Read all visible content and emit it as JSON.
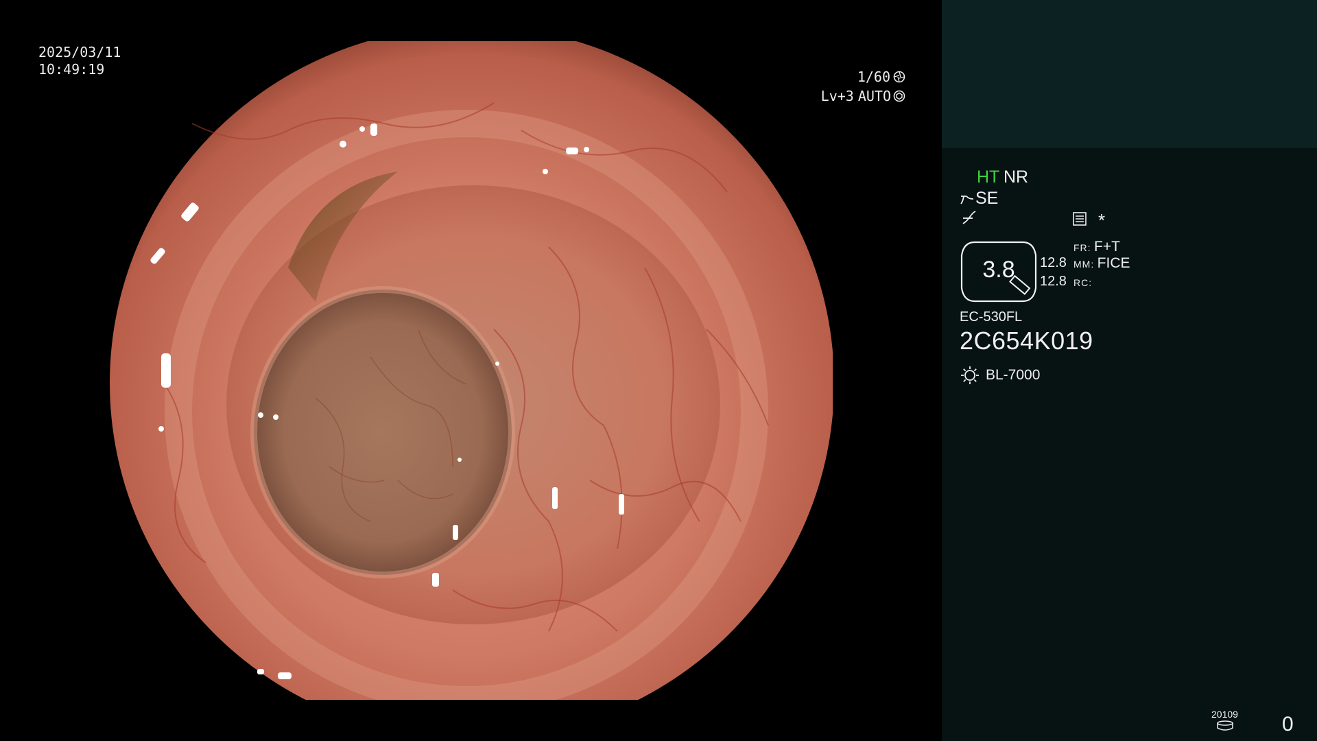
{
  "overlay": {
    "date": "2025/03/11",
    "time": "10:49:19",
    "shutter": "1/60",
    "shutter_icon": "aperture-icon",
    "level": "Lv+3",
    "exposure_mode": "AUTO",
    "exposure_icon": "iris-icon"
  },
  "panel": {
    "ht_label": "HT",
    "nr_label": "NR",
    "se_label": "SE",
    "star_label": "*",
    "zoom_value": "3.8",
    "value_1": "12.8",
    "value_2": "12.8",
    "mode_fr_key": "FR:",
    "mode_fr_val": "F+T",
    "mode_mm_key": "MM:",
    "mode_mm_val": "FICE",
    "mode_rc_key": "RC:",
    "mode_rc_val": "",
    "scope_model": "EC-530FL",
    "scope_serial": "2C654K019",
    "light_source": "BL-7000",
    "counter_small": "20109",
    "counter_big": "0"
  },
  "colors": {
    "panel_top": "#0c2222",
    "panel_bottom": "#071212",
    "ht_green": "#3fd13f",
    "mucosa": "#c8705c",
    "lumen": "#9a6a52"
  }
}
